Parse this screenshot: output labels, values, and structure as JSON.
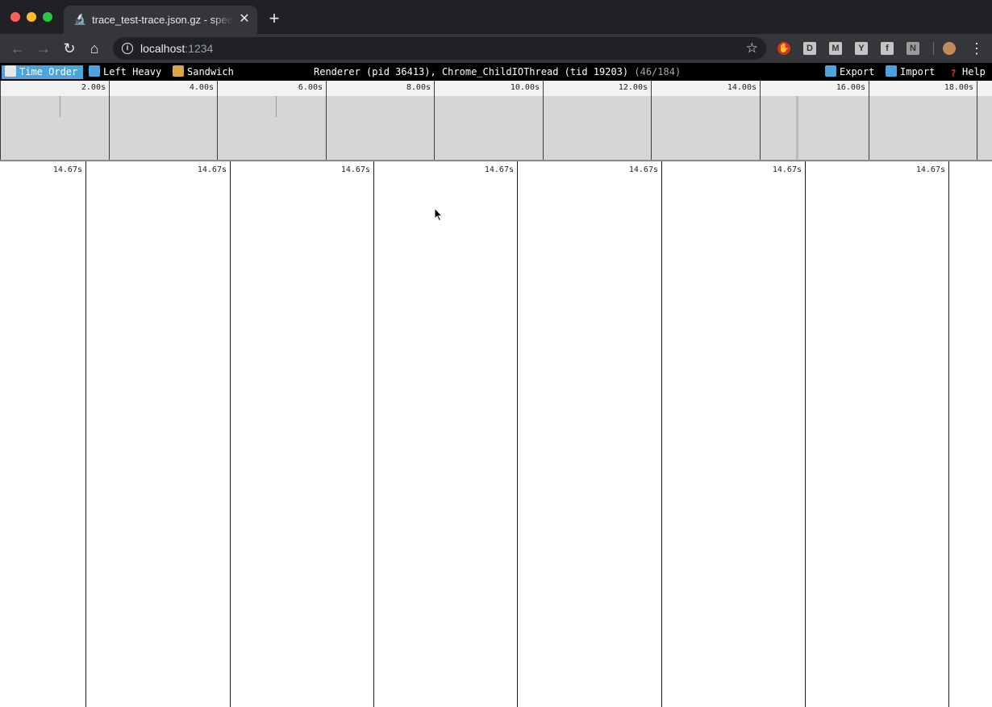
{
  "browser": {
    "tab_title": "trace_test-trace.json.gz - speedscope",
    "url_host": "localhost",
    "url_port": ":1234",
    "extensions": [
      "D",
      "M",
      "Y",
      "f",
      "N"
    ]
  },
  "app": {
    "views": [
      {
        "label": "Time Order",
        "active": true,
        "icon": "clock-icon"
      },
      {
        "label": "Left Heavy",
        "active": false,
        "icon": "arrow-left-icon"
      },
      {
        "label": "Sandwich",
        "active": false,
        "icon": "sandwich-icon"
      }
    ],
    "title": "Renderer (pid 36413), Chrome_ChildIOThread (tid 19203)",
    "profile_count": "(46/184)",
    "actions": [
      {
        "label": "Export",
        "icon": "export-icon"
      },
      {
        "label": "Import",
        "icon": "import-icon"
      },
      {
        "label": "Help",
        "icon": "question-icon"
      }
    ]
  },
  "minimap": {
    "tick_labels": [
      "2.00s",
      "4.00s",
      "6.00s",
      "8.00s",
      "10.00s",
      "12.00s",
      "14.00s",
      "16.00s",
      "18.00s"
    ]
  },
  "flamechart": {
    "tick_labels": [
      "14.67s",
      "14.67s",
      "14.67s",
      "14.67s",
      "14.67s",
      "14.67s",
      "14.67s"
    ]
  }
}
